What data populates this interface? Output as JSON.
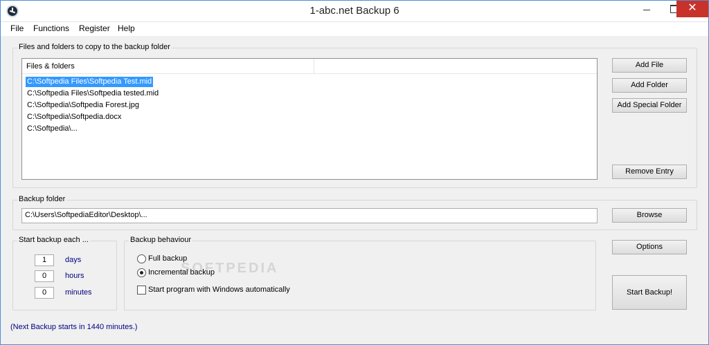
{
  "window": {
    "title": "1-abc.net Backup 6",
    "icon": "app-icon"
  },
  "menu": [
    "File",
    "Functions",
    "Register",
    "Help"
  ],
  "files_group": {
    "label": "Files and folders to copy to the backup folder",
    "column_header": "Files & folders",
    "items": [
      "C:\\Softpedia Files\\Softpedia Test.mid",
      "C:\\Softpedia Files\\Softpedia tested.mid",
      "C:\\Softpedia\\Softpedia Forest.jpg",
      "C:\\Softpedia\\Softpedia.docx",
      "C:\\Softpedia\\..."
    ],
    "selected_index": 0,
    "buttons": {
      "add_file": "Add File",
      "add_folder": "Add Folder",
      "add_special_folder": "Add Special Folder",
      "remove_entry": "Remove Entry"
    }
  },
  "backup_folder": {
    "label": "Backup folder",
    "path": "C:\\Users\\SoftpediaEditor\\Desktop\\...",
    "browse": "Browse"
  },
  "schedule": {
    "label": "Start backup each ...",
    "days_value": "1",
    "days_label": "days",
    "hours_value": "0",
    "hours_label": "hours",
    "minutes_value": "0",
    "minutes_label": "minutes"
  },
  "behaviour": {
    "label": "Backup behaviour",
    "full_backup": "Full backup",
    "incremental_backup": "Incremental backup",
    "selected": "incremental_backup",
    "start_with_windows": "Start program with Windows automatically",
    "start_with_windows_checked": false
  },
  "options_button": "Options",
  "start_button": "Start Backup!",
  "status": "(Next Backup starts in 1440 minutes.)",
  "watermark": "SOFTPEDIA",
  "colors": {
    "selection": "#3399ff",
    "accent_text": "#000080",
    "close_button": "#c7332b",
    "window_border": "#4d8ed6"
  }
}
